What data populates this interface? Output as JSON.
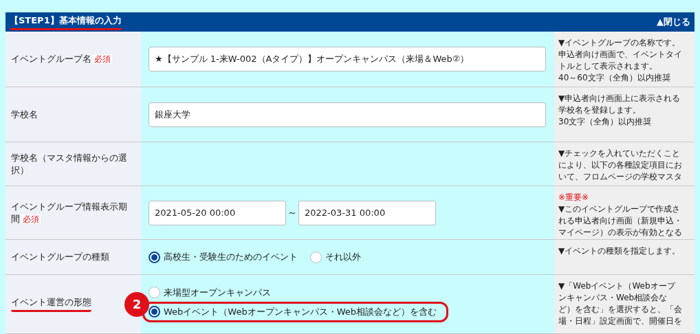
{
  "section": {
    "title": "【STEP1】基本情報の入力",
    "title_underlined": true,
    "toggle": "▲閉じる"
  },
  "rows": [
    {
      "kind": "text",
      "label": "イベントグループ名",
      "required": "必須",
      "value": "★【サンプル 1-来W-002（Aタイプ）】オープンキャンパス（来場＆Web②）",
      "help": {
        "lines": [
          "▼イベントグループの名称です。",
          "申込者向け画面で、イベントタイ",
          "トルとして表示されます。",
          "40～60文字（全角）以内推奨"
        ]
      }
    },
    {
      "kind": "text",
      "label": "学校名",
      "value": "銀座大学",
      "help": {
        "lines": [
          "▼申込者向け画面上に表示される",
          "学校名を登録します。",
          "30文字（全角）以内推奨"
        ]
      }
    },
    {
      "kind": "empty",
      "label": "学校名（マスタ情報からの選択）",
      "help": {
        "lines": [
          "▼チェックを入れていただくこと",
          "により、以下の各種設定項目にお",
          "いて、フロムページの学校マスタ"
        ]
      }
    },
    {
      "kind": "range",
      "label": "イベントグループ情報表示期間",
      "required": "必須",
      "from": "2021-05-20 00:00",
      "separator": "～",
      "to": "2022-03-31 00:00",
      "help": {
        "note": "※重要※",
        "lines": [
          "▼このイベントグループで作成さ",
          "れる申込者向け画面（新規申込・",
          "マイページ）の表示が有効となる"
        ]
      }
    },
    {
      "kind": "radio-inline",
      "label": "イベントグループの種類",
      "options": [
        {
          "label": "高校生・受験生のためのイベント",
          "selected": true
        },
        {
          "label": "それ以外",
          "selected": false
        }
      ],
      "help": {
        "lines": [
          "▼イベントの種類を指定します。"
        ]
      }
    },
    {
      "kind": "radio-stack",
      "label": "イベント運営の形態",
      "label_underlined": true,
      "badge": "2",
      "options": [
        {
          "label": "来場型オープンキャンパス",
          "selected": false,
          "highlighted": false
        },
        {
          "label": "Webイベント（Webオープンキャンパス・Web相談会など）を含む",
          "selected": true,
          "highlighted": true
        }
      ],
      "help": {
        "lines": [
          "▼「Webイベント（Webオープ",
          "ンキャンパス・Web相談会な",
          "ど）を含む」を選択すると、「会",
          "場・日程」設定画面で、開催日を"
        ]
      }
    }
  ]
}
